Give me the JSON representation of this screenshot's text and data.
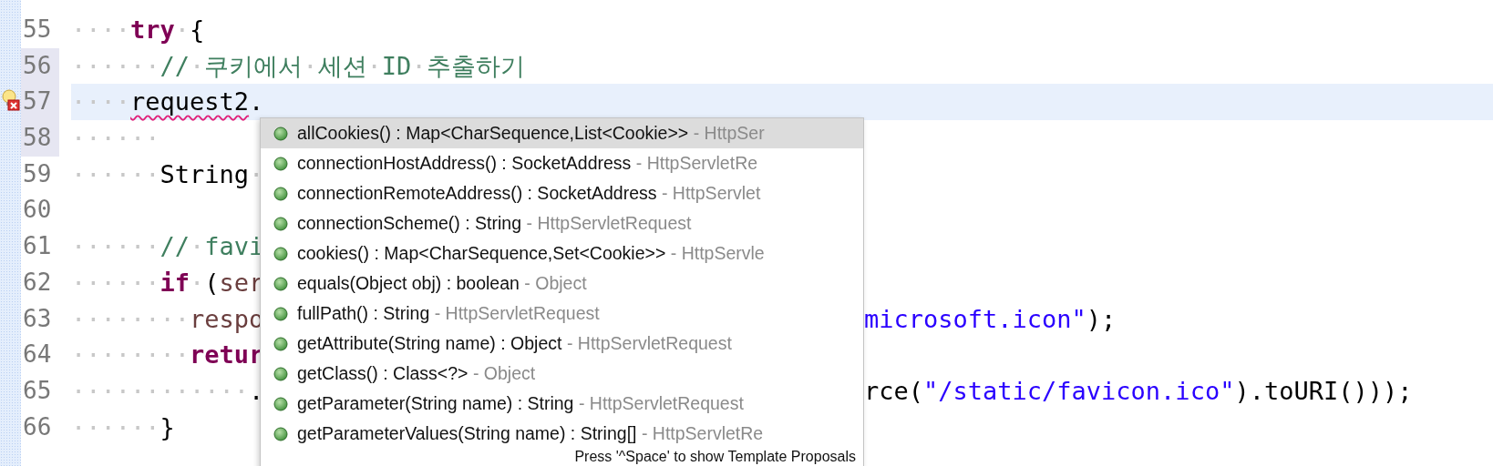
{
  "editor": {
    "lines": [
      {
        "number": "55",
        "marked": false,
        "current": false,
        "problem": false,
        "tokens": [
          {
            "kind": "ws",
            "text": "····"
          },
          {
            "kind": "keyword",
            "text": "try"
          },
          {
            "kind": "ws",
            "text": "·"
          },
          {
            "kind": "plain",
            "text": "{"
          }
        ]
      },
      {
        "number": "56",
        "marked": true,
        "current": false,
        "problem": false,
        "tokens": [
          {
            "kind": "ws",
            "text": "······"
          },
          {
            "kind": "comment",
            "text": "//"
          },
          {
            "kind": "ws",
            "text": "·"
          },
          {
            "kind": "comment",
            "text": "쿠키에서"
          },
          {
            "kind": "ws",
            "text": "·"
          },
          {
            "kind": "comment",
            "text": "세션"
          },
          {
            "kind": "ws",
            "text": "·"
          },
          {
            "kind": "comment",
            "text": "ID"
          },
          {
            "kind": "ws",
            "text": "·"
          },
          {
            "kind": "comment",
            "text": "추출하기"
          }
        ]
      },
      {
        "number": "57",
        "marked": true,
        "current": true,
        "problem": true,
        "tokens": [
          {
            "kind": "ws",
            "text": "····"
          },
          {
            "kind": "error",
            "text": "request2"
          },
          {
            "kind": "plain",
            "text": "."
          }
        ]
      },
      {
        "number": "58",
        "marked": true,
        "current": false,
        "problem": false,
        "tokens": [
          {
            "kind": "ws",
            "text": "······"
          }
        ]
      },
      {
        "number": "59",
        "marked": false,
        "current": false,
        "problem": false,
        "tokens": [
          {
            "kind": "ws",
            "text": "······"
          },
          {
            "kind": "plain",
            "text": "String"
          },
          {
            "kind": "ws",
            "text": "·"
          }
        ]
      },
      {
        "number": "60",
        "marked": false,
        "current": false,
        "problem": false
      },
      {
        "number": "61",
        "marked": false,
        "current": false,
        "problem": false,
        "tokens": [
          {
            "kind": "ws",
            "text": "······"
          },
          {
            "kind": "comment",
            "text": "//"
          },
          {
            "kind": "ws",
            "text": "·"
          },
          {
            "kind": "comment",
            "text": "favi"
          }
        ]
      },
      {
        "number": "62",
        "marked": false,
        "current": false,
        "problem": false,
        "tokens": [
          {
            "kind": "ws",
            "text": "······"
          },
          {
            "kind": "keyword",
            "text": "if"
          },
          {
            "kind": "ws",
            "text": "·"
          },
          {
            "kind": "plain",
            "text": "("
          },
          {
            "kind": "field",
            "text": "ser"
          }
        ]
      },
      {
        "number": "63",
        "marked": false,
        "current": false,
        "problem": false,
        "tokens": [
          {
            "kind": "ws",
            "text": "········"
          },
          {
            "kind": "field",
            "text": "respo"
          }
        ],
        "tail": [
          {
            "kind": "string",
            "text": "microsoft.icon\""
          },
          {
            "kind": "plain",
            "text": ");"
          }
        ]
      },
      {
        "number": "64",
        "marked": false,
        "current": false,
        "problem": false,
        "tokens": [
          {
            "kind": "ws",
            "text": "········"
          },
          {
            "kind": "keyword",
            "text": "retur"
          }
        ]
      },
      {
        "number": "65",
        "marked": false,
        "current": false,
        "problem": false,
        "tokens": [
          {
            "kind": "ws",
            "text": "············"
          },
          {
            "kind": "plain",
            "text": "."
          }
        ],
        "tail": [
          {
            "kind": "plain",
            "text": "rce("
          },
          {
            "kind": "string",
            "text": "\"/static/favicon.ico\""
          },
          {
            "kind": "plain",
            "text": ").toURI()));"
          }
        ]
      },
      {
        "number": "66",
        "marked": false,
        "current": false,
        "problem": false,
        "tokens": [
          {
            "kind": "ws",
            "text": "······"
          },
          {
            "kind": "plain",
            "text": "}"
          }
        ]
      }
    ]
  },
  "completion": {
    "items": [
      {
        "kind": "method",
        "signature": "allCookies() : Map<CharSequence,List<Cookie>>",
        "qualifier": "- HttpSer",
        "selected": true
      },
      {
        "kind": "method",
        "signature": "connectionHostAddress() : SocketAddress",
        "qualifier": "- HttpServletRe",
        "selected": false
      },
      {
        "kind": "method",
        "signature": "connectionRemoteAddress() : SocketAddress",
        "qualifier": "- HttpServlet",
        "selected": false
      },
      {
        "kind": "method",
        "signature": "connectionScheme() : String",
        "qualifier": "- HttpServletRequest",
        "selected": false
      },
      {
        "kind": "method",
        "signature": "cookies() : Map<CharSequence,Set<Cookie>>",
        "qualifier": "- HttpServle",
        "selected": false
      },
      {
        "kind": "method",
        "signature": "equals(Object obj) : boolean",
        "qualifier": "- Object",
        "selected": false
      },
      {
        "kind": "method",
        "signature": "fullPath() : String",
        "qualifier": "- HttpServletRequest",
        "selected": false
      },
      {
        "kind": "method",
        "signature": "getAttribute(String name) : Object",
        "qualifier": "- HttpServletRequest",
        "selected": false
      },
      {
        "kind": "method",
        "signature": "getClass() : Class<?>",
        "qualifier": "- Object",
        "selected": false
      },
      {
        "kind": "method",
        "signature": "getParameter(String name) : String",
        "qualifier": "- HttpServletRequest",
        "selected": false
      },
      {
        "kind": "method",
        "signature": "getParameterValues(String name) : String[]",
        "qualifier": "- HttpServletRe",
        "selected": false
      }
    ],
    "hint": "Press '^Space' to show Template Proposals"
  }
}
